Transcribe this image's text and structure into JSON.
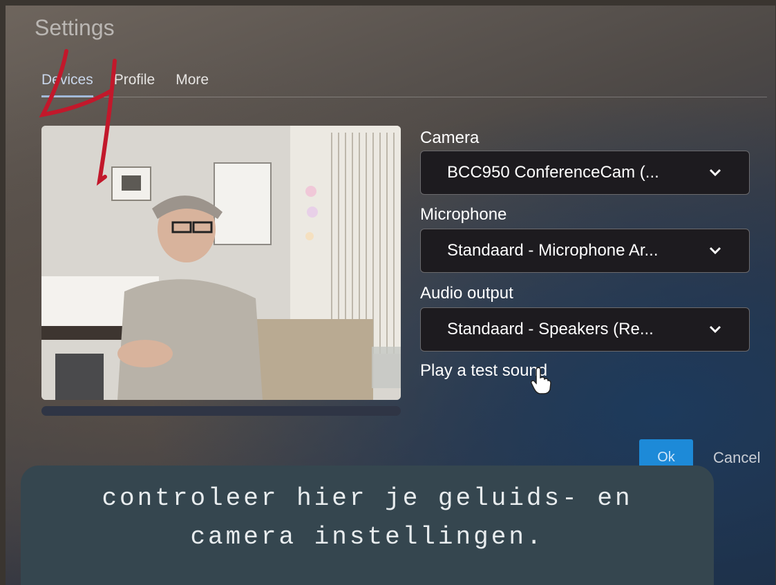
{
  "dialog": {
    "title": "Settings",
    "tabs": [
      {
        "label": "Devices",
        "active": true
      },
      {
        "label": "Profile",
        "active": false
      },
      {
        "label": "More",
        "active": false
      }
    ]
  },
  "devices": {
    "camera": {
      "label": "Camera",
      "value": "BCC950 ConferenceCam (..."
    },
    "microphone": {
      "label": "Microphone",
      "value": "Standaard - Microphone Ar..."
    },
    "audio_output": {
      "label": "Audio output",
      "value": "Standaard - Speakers (Re..."
    },
    "test_sound_label": "Play a test sound"
  },
  "footer": {
    "ok_label": "Ok",
    "cancel_label": "Cancel"
  },
  "caption": {
    "line1": "controleer hier je geluids- en",
    "line2": "camera instellingen."
  },
  "annotation": {
    "number": "4",
    "color": "#c2182b"
  },
  "colors": {
    "primary": "#1d8ad8",
    "select_bg": "#1d1b1f",
    "caption_bg": "#35464f"
  }
}
